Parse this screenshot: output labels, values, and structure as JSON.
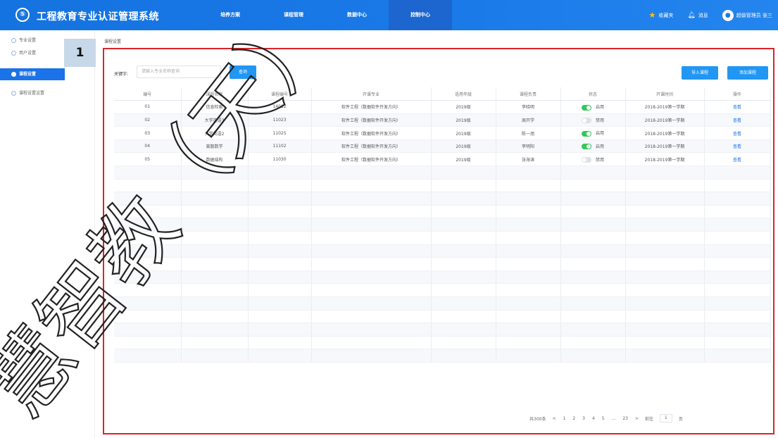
{
  "header": {
    "logo_glyph": "⑤",
    "title": "工程教育专业认证管理系统",
    "nav": [
      {
        "label": "培养方案",
        "active": false
      },
      {
        "label": "课程管理",
        "active": false
      },
      {
        "label": "数据中心",
        "active": false
      },
      {
        "label": "控制中心",
        "active": true
      }
    ],
    "favorites": "收藏夹",
    "messages": "消息",
    "user": "超级管理员 张三"
  },
  "sidebar": {
    "items": [
      {
        "label": "专业设置",
        "active": false
      },
      {
        "label": "用户设置",
        "active": false
      },
      {
        "label": "课程设置",
        "active": true
      },
      {
        "label": "课程设置设置",
        "active": false
      }
    ],
    "badge": "1"
  },
  "breadcrumb": "课程设置",
  "toolbar": {
    "keyword_label": "关键字:",
    "keyword_placeholder": "请输入专业名称查询",
    "search_button": "查询",
    "import_button": "导入课程",
    "add_button": "添加课程"
  },
  "table": {
    "columns": [
      "编号",
      "课程名称",
      "课程编号",
      "开课专业",
      "适用年级",
      "课程负责",
      "状态",
      "开课时间",
      "操作"
    ],
    "rows": [
      {
        "id": "01",
        "name": "信息检索",
        "code": "14012",
        "major": "软件工程（数据软件开发方向）",
        "grade": "2019级",
        "owner": "李晓明",
        "enabled": true,
        "status": "启用",
        "term": "2018-2019第一学期",
        "op": "查看"
      },
      {
        "id": "02",
        "name": "大学英语3",
        "code": "11023",
        "major": "软件工程（数据软件开发方向）",
        "grade": "2019级",
        "owner": "周开学",
        "enabled": false,
        "status": "禁用",
        "term": "2018-2019第一学期",
        "op": "查看"
      },
      {
        "id": "03",
        "name": "大学英语2",
        "code": "11025",
        "major": "软件工程（数据软件开发方向）",
        "grade": "2019级",
        "owner": "陈一旭",
        "enabled": true,
        "status": "启用",
        "term": "2018-2019第一学期",
        "op": "查看"
      },
      {
        "id": "04",
        "name": "离散数学",
        "code": "11102",
        "major": "软件工程（数据软件开发方向）",
        "grade": "2019级",
        "owner": "李明阳",
        "enabled": true,
        "status": "启用",
        "term": "2018-2019第一学期",
        "op": "查看"
      },
      {
        "id": "05",
        "name": "数据结构",
        "code": "11030",
        "major": "软件工程（数据软件开发方向）",
        "grade": "2019级",
        "owner": "张海涛",
        "enabled": false,
        "status": "禁用",
        "term": "2018-2019第一学期",
        "op": "查看"
      }
    ],
    "empty_rows": 15
  },
  "pagination": {
    "total": "共300条",
    "pages": [
      "<",
      "1",
      "2",
      "3",
      "4",
      "5",
      "...",
      "23",
      ">"
    ],
    "goto_label": "前往",
    "goto_value": "1",
    "page_unit": "页"
  },
  "watermark": "慧智教（天）",
  "colors": {
    "header_bg": "#1a78e6",
    "active_nav": "#1d66cf",
    "sidebar_active": "#1a73e8",
    "button": "#2196f3",
    "toggle_on": "#34c759",
    "panel_border": "#d9242a"
  }
}
